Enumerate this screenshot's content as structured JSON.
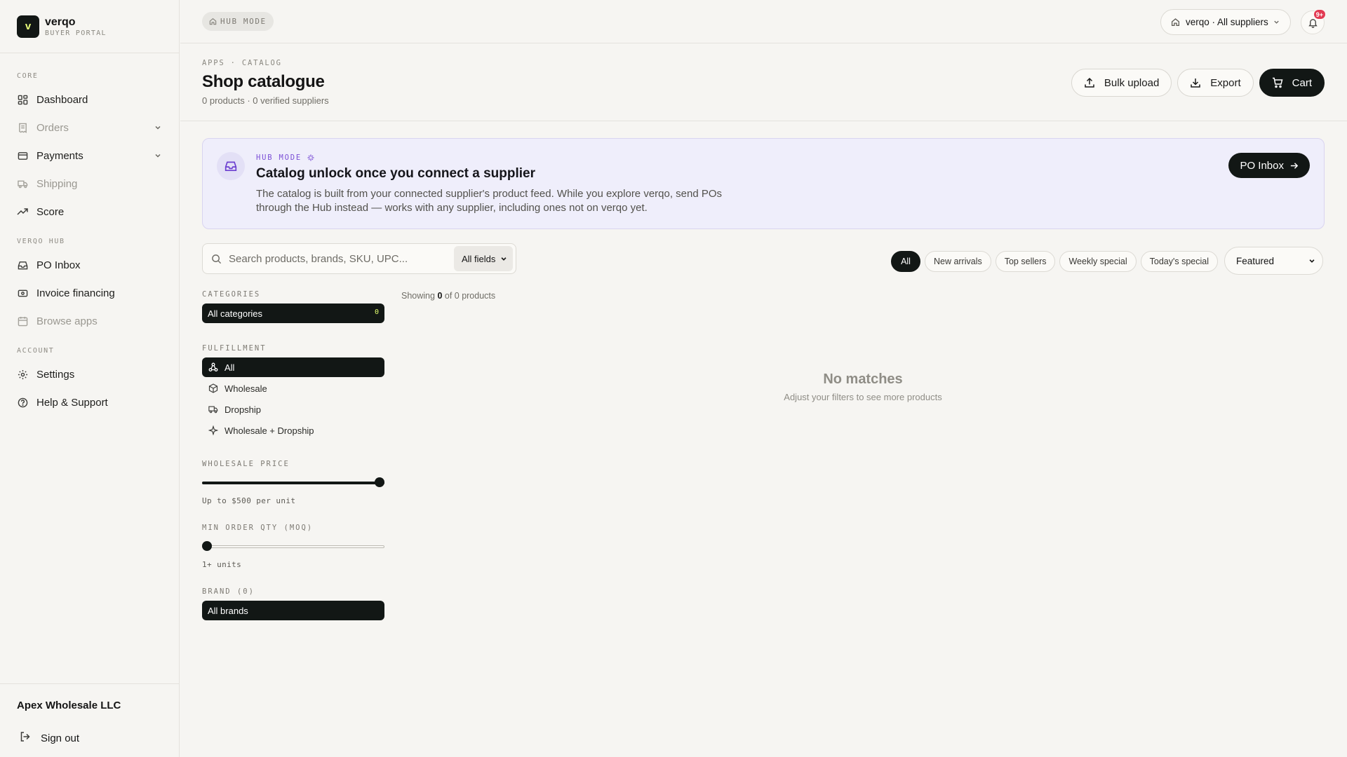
{
  "app": {
    "logo_letter": "v",
    "name": "verqo",
    "subtitle": "BUYER PORTAL"
  },
  "sidebar": {
    "sections": [
      {
        "title": "CORE",
        "items": [
          {
            "label": "Dashboard",
            "icon": "grid-icon",
            "muted": false,
            "has_chevron": false
          },
          {
            "label": "Orders",
            "icon": "receipt-icon",
            "muted": true,
            "has_chevron": true
          },
          {
            "label": "Payments",
            "icon": "credit-card-icon",
            "muted": false,
            "has_chevron": true
          },
          {
            "label": "Shipping",
            "icon": "truck-icon",
            "muted": true,
            "has_chevron": false
          },
          {
            "label": "Score",
            "icon": "trending-up-icon",
            "muted": false,
            "has_chevron": false
          }
        ]
      },
      {
        "title": "VERQO HUB",
        "items": [
          {
            "label": "PO Inbox",
            "icon": "inbox-icon",
            "muted": false,
            "has_chevron": false
          },
          {
            "label": "Invoice financing",
            "icon": "banknote-icon",
            "muted": false,
            "has_chevron": false
          },
          {
            "label": "Browse apps",
            "icon": "calendar-icon",
            "muted": true,
            "has_chevron": false
          }
        ]
      },
      {
        "title": "ACCOUNT",
        "items": [
          {
            "label": "Settings",
            "icon": "gear-icon",
            "muted": false,
            "has_chevron": false
          },
          {
            "label": "Help & Support",
            "icon": "help-circle-icon",
            "muted": false,
            "has_chevron": false
          }
        ]
      }
    ],
    "company": "Apex Wholesale LLC",
    "sign_out": "Sign out"
  },
  "topbar": {
    "hub_mode": "HUB MODE",
    "supplier_select": "verqo · All suppliers",
    "notification_count": "9+"
  },
  "header": {
    "breadcrumb": "APPS · CATALOG",
    "title": "Shop catalogue",
    "subtitle": "0 products · 0 verified suppliers",
    "actions": {
      "bulk_upload": "Bulk upload",
      "export": "Export",
      "cart": "Cart"
    }
  },
  "banner": {
    "kicker": "HUB MODE",
    "title": "Catalog unlock once you connect a supplier",
    "text": "The catalog is built from your connected supplier's product feed. While you explore verqo, send POs through the Hub instead — works with any supplier, including ones not on verqo yet.",
    "button": "PO Inbox"
  },
  "search": {
    "placeholder": "Search products, brands, SKU, UPC...",
    "field_select": "All fields"
  },
  "chips": [
    {
      "label": "All",
      "active": true
    },
    {
      "label": "New arrivals",
      "active": false
    },
    {
      "label": "Top sellers",
      "active": false
    },
    {
      "label": "Weekly special",
      "active": false
    },
    {
      "label": "Today's special",
      "active": false
    }
  ],
  "sort": "Featured",
  "filters": {
    "categories_label": "CATEGORIES",
    "all_categories": "All categories",
    "all_categories_count": "0",
    "fulfillment_label": "FULFILLMENT",
    "fulfillment": [
      {
        "label": "All",
        "icon": "network-icon",
        "active": true
      },
      {
        "label": "Wholesale",
        "icon": "package-icon",
        "active": false
      },
      {
        "label": "Dropship",
        "icon": "truck-icon",
        "active": false
      },
      {
        "label": "Wholesale + Dropship",
        "icon": "sparkle-icon",
        "active": false
      }
    ],
    "price_label": "WHOLESALE PRICE",
    "price_level": 1.0,
    "price_note": "Up to $500 per unit",
    "moq_label": "MIN ORDER QTY (MOQ)",
    "moq_level": 0.0,
    "moq_note": "1+ units",
    "brand_label": "BRAND (0)",
    "all_brands": "All brands"
  },
  "results": {
    "showing_prefix": "Showing",
    "shown": "0",
    "of_text": "of 0 products",
    "empty_title": "No matches",
    "empty_sub": "Adjust your filters to see more products"
  },
  "colors": {
    "accent_dark": "#121715",
    "accent_lime": "#e2ff6e",
    "hub_purple": "#7b4fd6",
    "badge_red": "#e23a52"
  }
}
